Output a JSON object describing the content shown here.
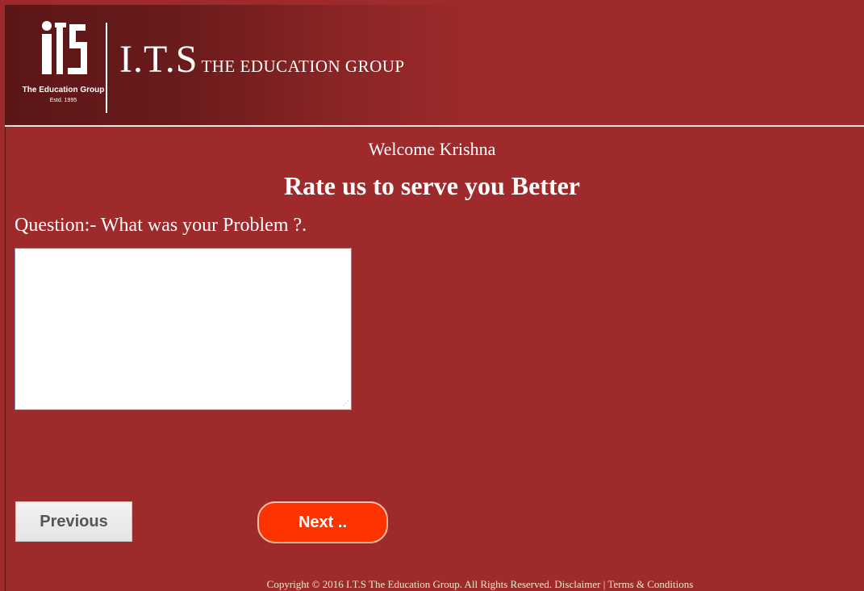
{
  "header": {
    "logo_tagline": "The Education Group",
    "logo_established": "Estd. 1995",
    "brand_main": "I.T.S",
    "brand_sub": "THE EDUCATION GROUP"
  },
  "main": {
    "welcome_text": "Welcome Krishna",
    "heading": "Rate us to serve you Better",
    "question": "Question:- What was your Problem ?.",
    "answer_value": ""
  },
  "buttons": {
    "previous_label": "Previous",
    "next_label": "Next .."
  },
  "footer": {
    "copyright": "Copyright © 2016 I.T.S The Education Group. All Rights Reserved.",
    "disclaimer": "Disclaimer",
    "separator": "|",
    "terms": "Terms & Conditions"
  },
  "colors": {
    "background": "#9e2a2b",
    "next_button": "#ff3300",
    "footer_text": "#f4e9c8"
  }
}
